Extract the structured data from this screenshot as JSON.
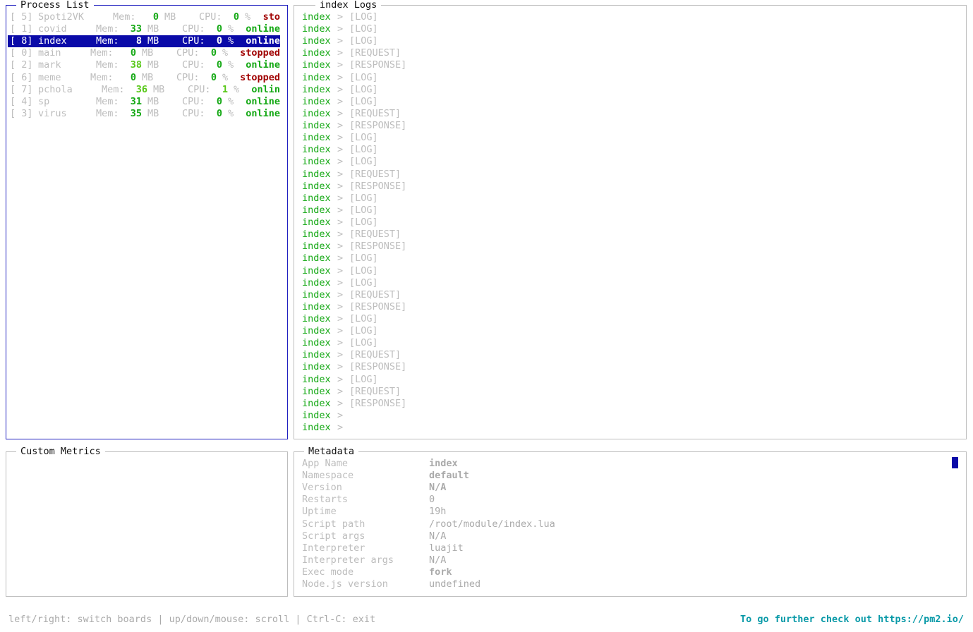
{
  "process_list": {
    "title": "Process List",
    "selected_index": 2,
    "mem_label": "Mem:",
    "mem_unit": "MB",
    "cpu_label": "CPU:",
    "cpu_unit": "%",
    "items": [
      {
        "id": "[ 5]",
        "name": "Spoti2VK",
        "mem": "0",
        "cpu": "0",
        "status": "sto",
        "status_color": "red"
      },
      {
        "id": "[ 1]",
        "name": "covid",
        "mem": "33",
        "cpu": "0",
        "status": "online",
        "status_color": "green"
      },
      {
        "id": "[ 8]",
        "name": "index",
        "mem": "8",
        "cpu": "0",
        "status": "online",
        "status_color": "green"
      },
      {
        "id": "[ 0]",
        "name": "main",
        "mem": "0",
        "cpu": "0",
        "status": "stopped",
        "status_color": "red"
      },
      {
        "id": "[ 2]",
        "name": "mark",
        "mem": "38",
        "cpu": "0",
        "status": "online",
        "status_color": "green"
      },
      {
        "id": "[ 6]",
        "name": "meme",
        "mem": "0",
        "cpu": "0",
        "status": "stopped",
        "status_color": "red"
      },
      {
        "id": "[ 7]",
        "name": "pchola",
        "mem": "36",
        "cpu": "1",
        "status": "onlin",
        "status_color": "green"
      },
      {
        "id": "[ 4]",
        "name": "sp",
        "mem": "31",
        "cpu": "0",
        "status": "online",
        "status_color": "green"
      },
      {
        "id": "[ 3]",
        "name": "virus",
        "mem": "35",
        "cpu": "0",
        "status": "online",
        "status_color": "green"
      }
    ]
  },
  "logs": {
    "title": "index Logs",
    "app": "index",
    "separator": ">",
    "lines": [
      "[LOG]",
      "[LOG]",
      "[LOG]",
      "[REQUEST]",
      "[RESPONSE]",
      "[LOG]",
      "[LOG]",
      "[LOG]",
      "[REQUEST]",
      "[RESPONSE]",
      "[LOG]",
      "[LOG]",
      "[LOG]",
      "[REQUEST]",
      "[RESPONSE]",
      "[LOG]",
      "[LOG]",
      "[LOG]",
      "[REQUEST]",
      "[RESPONSE]",
      "[LOG]",
      "[LOG]",
      "[LOG]",
      "[REQUEST]",
      "[RESPONSE]",
      "[LOG]",
      "[LOG]",
      "[LOG]",
      "[REQUEST]",
      "[RESPONSE]",
      "[LOG]",
      "[REQUEST]",
      "[RESPONSE]",
      "",
      ""
    ]
  },
  "custom_metrics": {
    "title": "Custom Metrics"
  },
  "metadata": {
    "title": "Metadata",
    "rows": [
      {
        "key": "App Name",
        "value": "index",
        "bold": true
      },
      {
        "key": "Namespace",
        "value": "default",
        "bold": true
      },
      {
        "key": "Version",
        "value": "N/A",
        "bold": true
      },
      {
        "key": "Restarts",
        "value": "0",
        "bold": false
      },
      {
        "key": "Uptime",
        "value": "19h",
        "bold": false
      },
      {
        "key": "Script path",
        "value": "/root/module/index.lua",
        "bold": false
      },
      {
        "key": "Script args",
        "value": "N/A",
        "bold": false
      },
      {
        "key": "Interpreter",
        "value": "luajit",
        "bold": false
      },
      {
        "key": "Interpreter args",
        "value": "N/A",
        "bold": false
      },
      {
        "key": "Exec mode",
        "value": "fork",
        "bold": true
      },
      {
        "key": "Node.js version",
        "value": "undefined",
        "bold": false
      }
    ]
  },
  "footer": {
    "help": "left/right: switch boards | up/down/mouse: scroll | Ctrl-C: exit",
    "link": "To go further check out https://pm2.io/"
  }
}
